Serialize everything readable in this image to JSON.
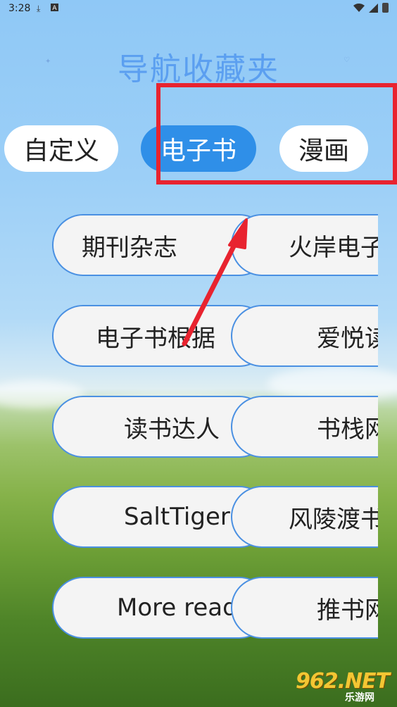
{
  "status_bar": {
    "time": "3:28",
    "icons": [
      "download-icon",
      "a-icon"
    ],
    "right_icons": [
      "wifi-icon",
      "signal-icon",
      "battery-icon"
    ]
  },
  "header": {
    "title": "导航收藏夹"
  },
  "tabs": [
    {
      "label": "自定义",
      "active": false
    },
    {
      "label": "电子书",
      "active": true
    },
    {
      "label": "漫画",
      "active": false
    }
  ],
  "items": {
    "left": [
      "期刊杂志",
      "电子书根据",
      "读书达人",
      "SaltTiger",
      "More read"
    ],
    "right": [
      "火岸电子",
      "爱悦读",
      "书栈网",
      "风陵渡书",
      "推书网"
    ]
  },
  "colors": {
    "accent": "#2f8fe8",
    "title": "#5b9ff0",
    "pill_border": "#4a90e2",
    "highlight": "#e8232f"
  },
  "watermark": {
    "top": "962.NET",
    "bottom": "乐游网"
  }
}
